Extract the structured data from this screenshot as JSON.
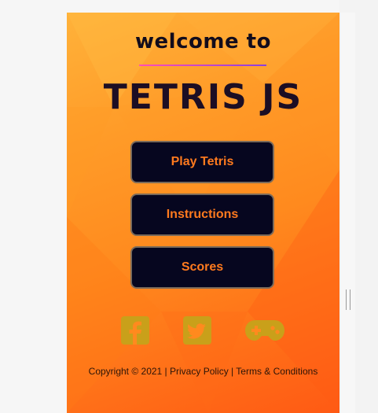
{
  "header": {
    "welcome_text": "welcome to",
    "title": "TETRIS JS"
  },
  "menu": {
    "play_label": "Play Tetris",
    "instructions_label": "Instructions",
    "scores_label": "Scores"
  },
  "social": {
    "icons": [
      "facebook-icon",
      "twitter-icon",
      "gamepad-icon"
    ],
    "icon_color": "#c9a01a"
  },
  "footer": {
    "copyright": "Copyright © 2021",
    "separator": " | ",
    "privacy": "Privacy Policy",
    "terms": "Terms & Conditions"
  },
  "colors": {
    "button_bg": "#06061f",
    "button_text": "#ff7a1e",
    "title_text": "#1c0e24"
  }
}
